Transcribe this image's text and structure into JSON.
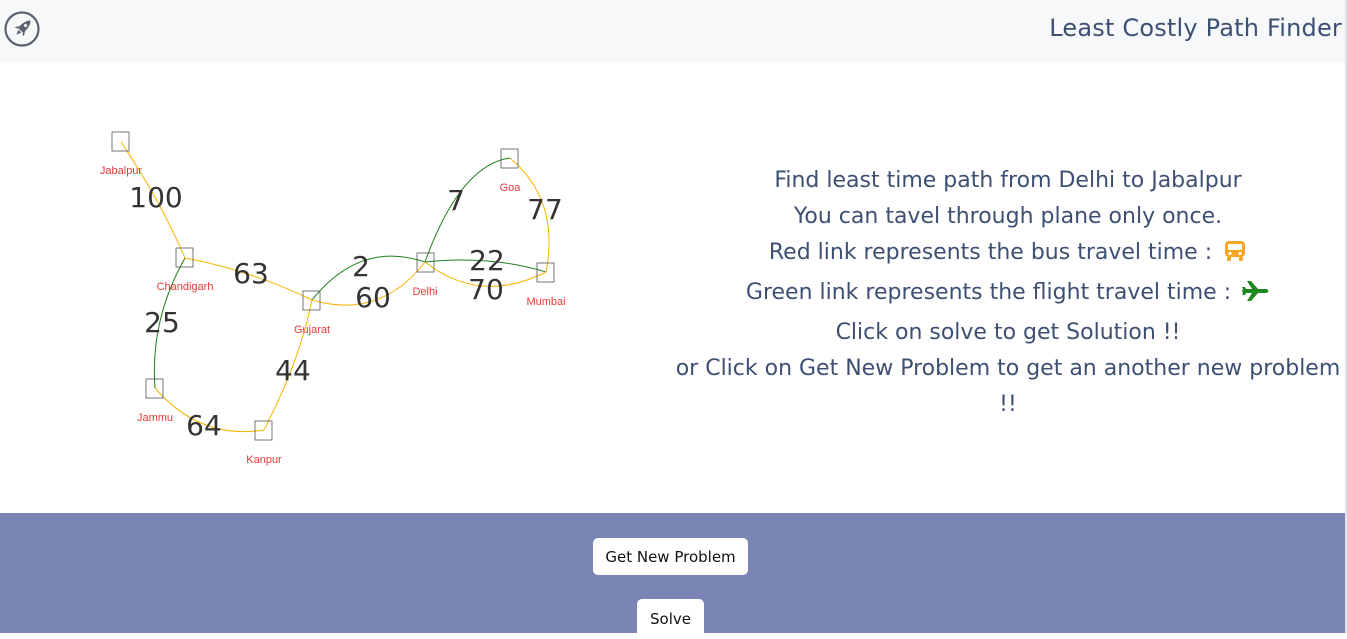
{
  "header": {
    "title": "Least Costly Path Finder",
    "logo_icon": "rocket-icon"
  },
  "graph": {
    "bus_color": "#f4b400",
    "flight_color": "#1e7e1e",
    "nodes": [
      {
        "id": "jabalpur",
        "label": "Jabalpur"
      },
      {
        "id": "chandigarh",
        "label": "Chandigarh"
      },
      {
        "id": "gujarat",
        "label": "Gujarat"
      },
      {
        "id": "delhi",
        "label": "Delhi"
      },
      {
        "id": "goa",
        "label": "Goa"
      },
      {
        "id": "mumbai",
        "label": "Mumbai"
      },
      {
        "id": "jammu",
        "label": "Jammu"
      },
      {
        "id": "kanpur",
        "label": "Kanpur"
      }
    ],
    "edges": [
      {
        "from": "Jabalpur",
        "to": "Chandigarh",
        "cost": "100",
        "mode": "bus"
      },
      {
        "from": "Chandigarh",
        "to": "Gujarat",
        "cost": "63",
        "mode": "bus"
      },
      {
        "from": "Gujarat",
        "to": "Delhi",
        "cost": "2",
        "mode": "flight"
      },
      {
        "from": "Gujarat",
        "to": "Delhi",
        "cost": "60",
        "mode": "bus"
      },
      {
        "from": "Delhi",
        "to": "Goa",
        "cost": "7",
        "mode": "flight"
      },
      {
        "from": "Goa",
        "to": "Mumbai",
        "cost": "77",
        "mode": "bus"
      },
      {
        "from": "Delhi",
        "to": "Mumbai",
        "cost": "22",
        "mode": "flight"
      },
      {
        "from": "Delhi",
        "to": "Mumbai",
        "cost": "70",
        "mode": "bus"
      },
      {
        "from": "Chandigarh",
        "to": "Jammu",
        "cost": "25",
        "mode": "flight"
      },
      {
        "from": "Jammu",
        "to": "Kanpur",
        "cost": "64",
        "mode": "bus"
      },
      {
        "from": "Kanpur",
        "to": "Gujarat",
        "cost": "44",
        "mode": "bus"
      }
    ]
  },
  "instructions": {
    "line1": "Find least time path from Delhi to Jabalpur",
    "line2": "You can tavel through plane only once.",
    "line3": "Red link represents the bus travel time :",
    "line3_icon": "bus-icon",
    "line4": "Green link represents the flight travel time :",
    "line4_icon": "plane-icon",
    "line5": "Click on solve to get Solution !!",
    "line6": "or Click on Get New Problem to get an another new problem",
    "line7": "!!",
    "bus_icon_color": "#f5a623",
    "plane_icon_color": "#1e8a1e"
  },
  "footer": {
    "new_problem_label": "Get New Problem",
    "solve_label": "Solve",
    "background": "#7b85b5"
  }
}
